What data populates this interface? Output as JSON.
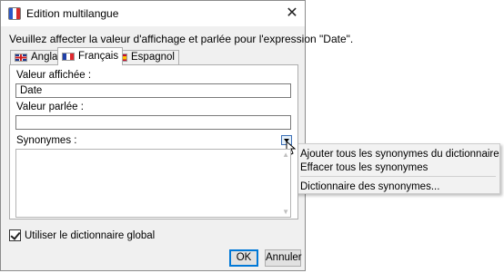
{
  "window": {
    "title": "Edition multilangue"
  },
  "instruction": "Veuillez affecter la valeur d'affichage et parlée pour l'expression \"Date\".",
  "tabs": [
    {
      "label": "Anglais",
      "flag": "uk-flag-icon"
    },
    {
      "label": "Français",
      "flag": "fr-flag-icon",
      "selected": true
    },
    {
      "label": "Espagnol",
      "flag": "es-flag-icon"
    }
  ],
  "form": {
    "display_label": "Valeur affichée :",
    "display_value": "Date",
    "spoken_label": "Valeur parlée :",
    "spoken_value": "",
    "synonyms_label": "Synonymes :"
  },
  "checkbox": {
    "label": "Utiliser le dictionnaire global",
    "checked": true
  },
  "buttons": {
    "ok": "OK",
    "cancel": "Annuler"
  },
  "context_menu": {
    "items": [
      "Ajouter tous les synonymes du dictionnaire",
      "Effacer tous les synonymes",
      "Dictionnaire des synonymes..."
    ]
  }
}
